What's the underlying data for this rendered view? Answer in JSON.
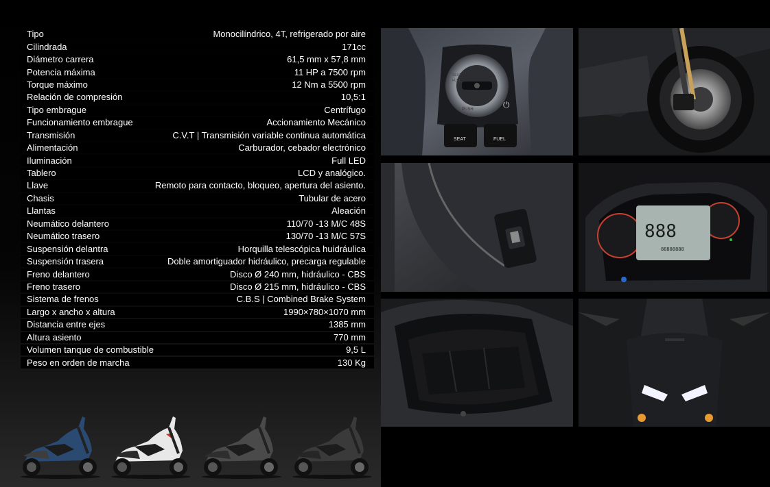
{
  "specs": [
    {
      "label": "Tipo",
      "value": "Monocilíndrico, 4T, refrigerado por aire"
    },
    {
      "label": "Cilindrada",
      "value": "171cc"
    },
    {
      "label": "Diámetro carrera",
      "value": "61,5 mm x 57,8 mm"
    },
    {
      "label": "Potencia máxima",
      "value": "11 HP a 7500 rpm"
    },
    {
      "label": "Torque máximo",
      "value": "12 Nm a 5500 rpm"
    },
    {
      "label": "Relación de compresión",
      "value": "10,5:1"
    },
    {
      "label": "Tipo embrague",
      "value": "Centrífugo"
    },
    {
      "label": "Funcionamiento embrague",
      "value": "Accionamiento Mecánico"
    },
    {
      "label": "Transmisión",
      "value": "C.V.T | Transmisión variable continua automática"
    },
    {
      "label": "Alimentación",
      "value": "Carburador, cebador electrónico"
    },
    {
      "label": "Iluminación",
      "value": "Full LED"
    },
    {
      "label": "Tablero",
      "value": "LCD y analógico."
    },
    {
      "label": "Llave",
      "value": "Remoto para contacto, bloqueo, apertura del asiento."
    },
    {
      "label": "Chasis",
      "value": "Tubular de acero"
    },
    {
      "label": "Llantas",
      "value": "Aleación"
    },
    {
      "label": "Neumático delantero",
      "value": "110/70 -13 M/C 48S"
    },
    {
      "label": "Neumático trasero",
      "value": "130/70 -13 M/C 57S"
    },
    {
      "label": "Suspensión delantra",
      "value": "Horquilla telescópica huidráulica"
    },
    {
      "label": "Suspensión trasera",
      "value": "Doble amortiguador hidráulico, precarga regulable"
    },
    {
      "label": "Freno delantero",
      "value": "Disco Ø 240 mm, hidráulico - CBS"
    },
    {
      "label": "Freno trasero",
      "value": "Disco Ø 215 mm, hidráulico - CBS"
    },
    {
      "label": "Sistema de frenos",
      "value": "C.B.S | Combined Brake System"
    },
    {
      "label": "Largo x ancho x altura",
      "value": "1990×780×1070 mm"
    },
    {
      "label": "Distancia entre ejes",
      "value": "1385 mm"
    },
    {
      "label": "Altura asiento",
      "value": "770 mm"
    },
    {
      "label": "Volumen tanque de combustible",
      "value": "9,5 L"
    },
    {
      "label": "Peso en orden de marcha",
      "value": "130 Kg"
    }
  ],
  "photos": {
    "ignition": {
      "seat_label": "SEAT",
      "fuel_label": "FUEL",
      "push_label": "PUSH",
      "seat_small": "SEAT",
      "fuel_small": "FUEL"
    },
    "dashboard": {
      "lcd_value": "888",
      "odometer": "88888888"
    }
  },
  "bike_colors": [
    {
      "name": "blue",
      "color": "#2a4a72"
    },
    {
      "name": "white",
      "color": "#e8e8e8"
    },
    {
      "name": "gray",
      "color": "#4a4a4a"
    },
    {
      "name": "dark-gray",
      "color": "#3a3a3a"
    }
  ]
}
